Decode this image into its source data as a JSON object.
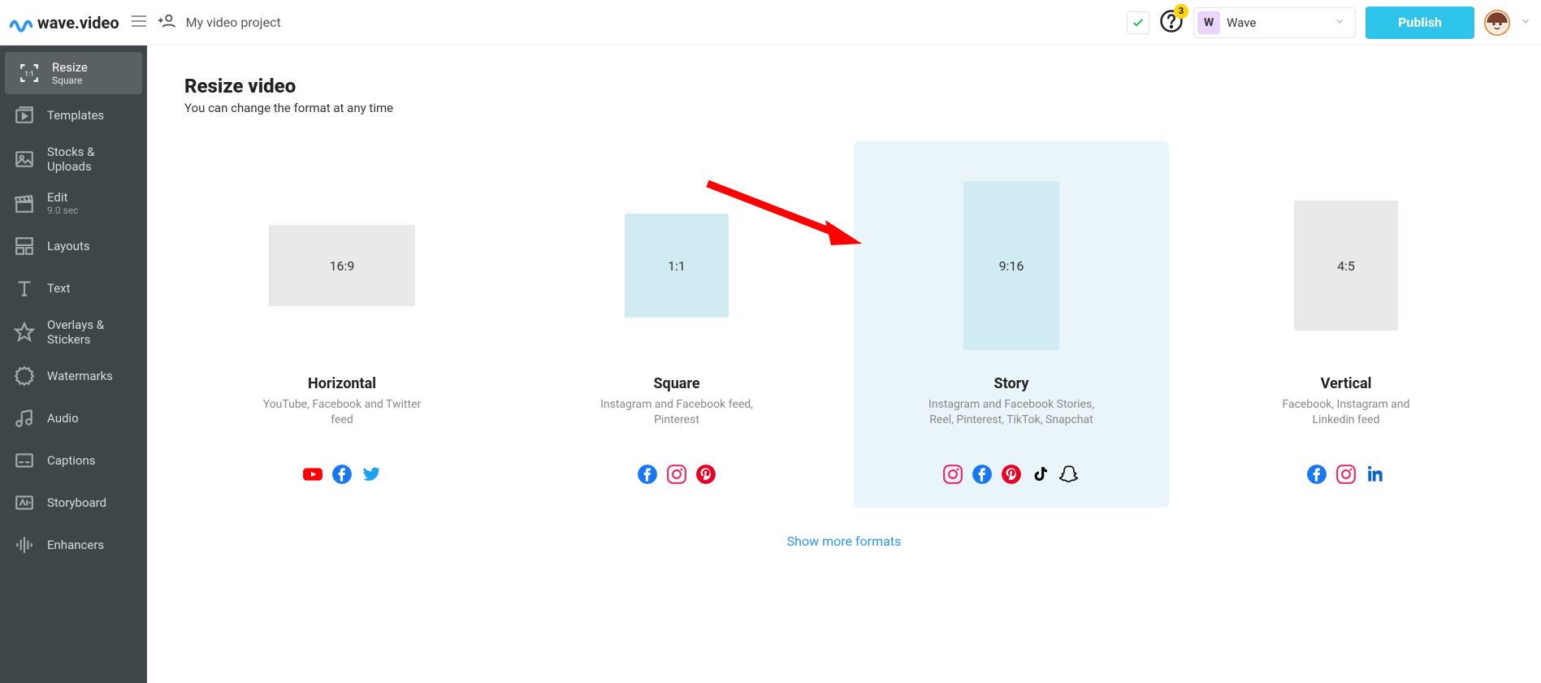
{
  "app": {
    "name": "wave.video"
  },
  "topbar": {
    "project_title": "My video project",
    "workspace_initial": "W",
    "workspace_name": "Wave",
    "publish_label": "Publish",
    "notifications_count": "3"
  },
  "sidebar": {
    "items": [
      {
        "label": "Resize",
        "sublabel": "Square"
      },
      {
        "label": "Templates"
      },
      {
        "label": "Stocks & Uploads"
      },
      {
        "label": "Edit",
        "sublabel": "9.0 sec"
      },
      {
        "label": "Layouts"
      },
      {
        "label": "Text"
      },
      {
        "label": "Overlays & Stickers"
      },
      {
        "label": "Watermarks"
      },
      {
        "label": "Audio"
      },
      {
        "label": "Captions"
      },
      {
        "label": "Storyboard"
      },
      {
        "label": "Enhancers"
      }
    ]
  },
  "main": {
    "heading": "Resize video",
    "subtitle": "You can change the format at any time",
    "show_more": "Show more formats",
    "formats": [
      {
        "ratio": "16:9",
        "title": "Horizontal",
        "desc": "YouTube, Facebook and Twitter feed"
      },
      {
        "ratio": "1:1",
        "title": "Square",
        "desc": "Instagram and Facebook feed, Pinterest"
      },
      {
        "ratio": "9:16",
        "title": "Story",
        "desc": "Instagram and Facebook Stories, Reel, Pinterest, TikTok, Snapchat"
      },
      {
        "ratio": "4:5",
        "title": "Vertical",
        "desc": "Facebook, Instagram and Linkedin feed"
      }
    ]
  }
}
